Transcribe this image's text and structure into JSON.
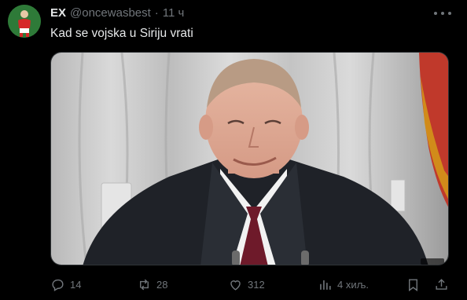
{
  "tweet": {
    "display_name": "EX",
    "handle": "@oncewasbest",
    "separator": "·",
    "time": "11 ч",
    "text": "Kad se vojska u Siriju vrati"
  },
  "actions": {
    "replies": "14",
    "reposts": "28",
    "likes": "312",
    "views": "4 хиљ."
  },
  "icons": {
    "reply": "reply-icon",
    "repost": "repost-icon",
    "like": "heart-icon",
    "views": "views-icon",
    "bookmark": "bookmark-icon",
    "share": "share-icon",
    "more": "more-icon"
  },
  "colors": {
    "background": "#000000",
    "text_primary": "#e7e9ea",
    "text_secondary": "#71767b"
  }
}
